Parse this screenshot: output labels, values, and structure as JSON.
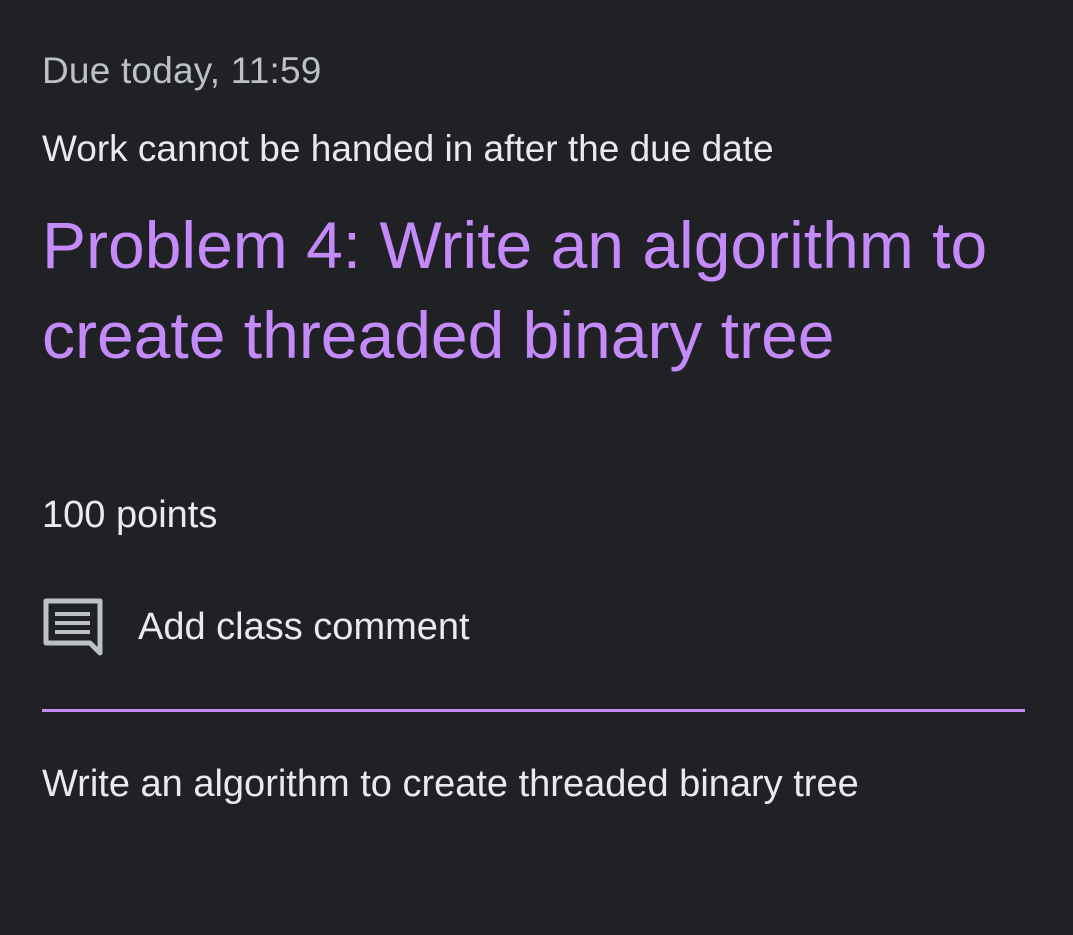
{
  "assignment": {
    "due": "Due today, 11:59",
    "notice": "Work cannot be handed in after the due date",
    "title": "Problem 4: Write an algorithm to create threaded binary tree",
    "points": "100 points",
    "description": "Write an algorithm to create threaded binary tree"
  },
  "comments": {
    "add_label": "Add class comment",
    "icon": "comment-icon"
  },
  "colors": {
    "background": "#202124",
    "accent": "#c58af9",
    "text_primary": "#e8eaed",
    "text_secondary": "#bdc1c6"
  }
}
